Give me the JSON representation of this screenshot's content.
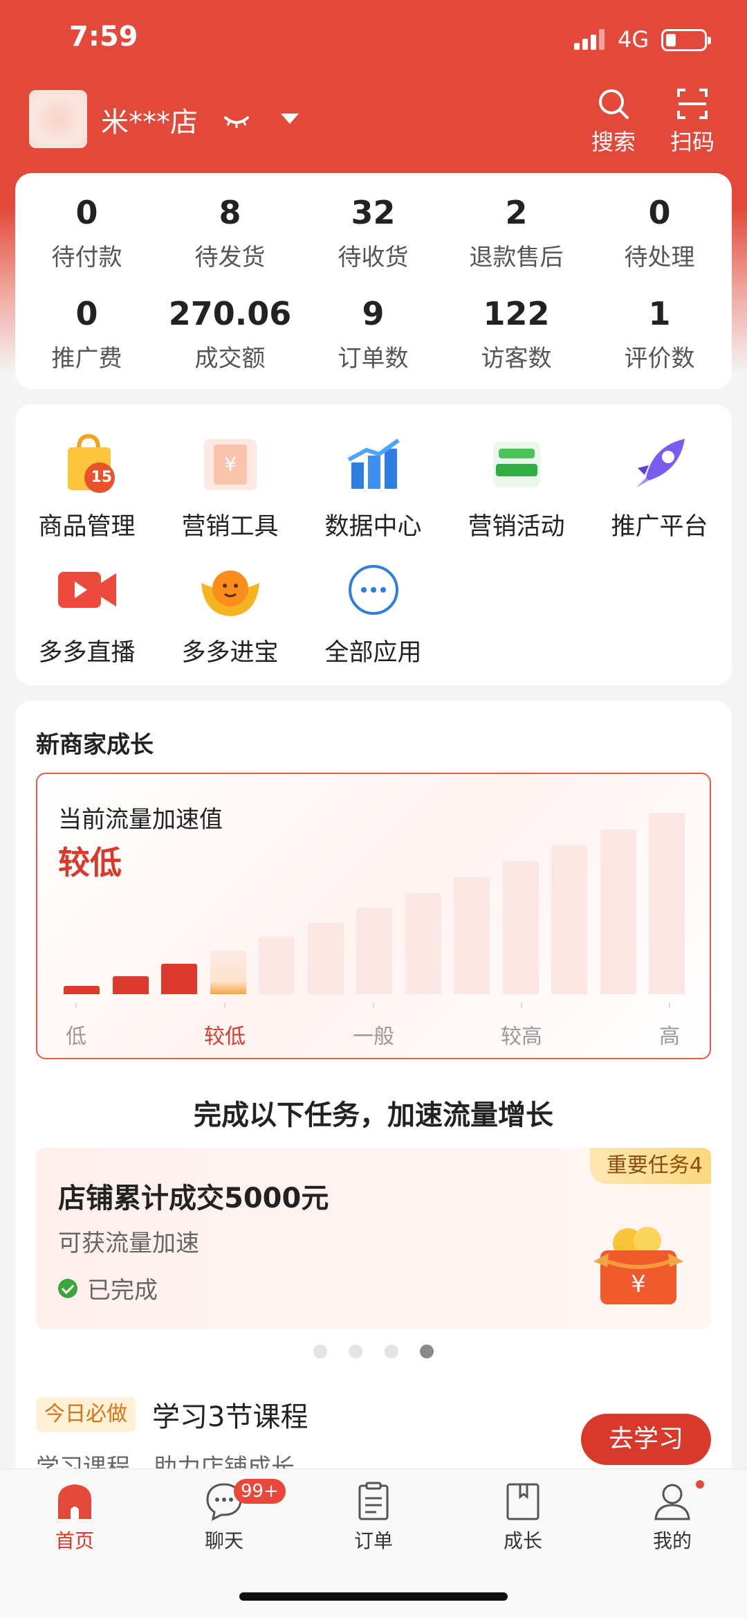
{
  "status_bar": {
    "time": "7:59",
    "network": "4G"
  },
  "header": {
    "shop_name": "米***店",
    "search_label": "搜索",
    "scan_label": "扫码"
  },
  "stats": [
    {
      "value": "0",
      "label": "待付款"
    },
    {
      "value": "8",
      "label": "待发货"
    },
    {
      "value": "32",
      "label": "待收货"
    },
    {
      "value": "2",
      "label": "退款售后"
    },
    {
      "value": "0",
      "label": "待处理"
    },
    {
      "value": "0",
      "label": "推广费"
    },
    {
      "value": "270.06",
      "label": "成交额"
    },
    {
      "value": "9",
      "label": "订单数"
    },
    {
      "value": "122",
      "label": "访客数"
    },
    {
      "value": "1",
      "label": "评价数"
    }
  ],
  "apps": [
    {
      "label": "商品管理",
      "icon": "shopping-bag-icon",
      "badge": "15"
    },
    {
      "label": "营销工具",
      "icon": "coupon-icon"
    },
    {
      "label": "数据中心",
      "icon": "bar-chart-icon"
    },
    {
      "label": "营销活动",
      "icon": "campaign-icon"
    },
    {
      "label": "推广平台",
      "icon": "rocket-icon"
    },
    {
      "label": "多多直播",
      "icon": "live-video-icon"
    },
    {
      "label": "多多进宝",
      "icon": "ingot-icon"
    },
    {
      "label": "全部应用",
      "icon": "more-icon"
    }
  ],
  "growth": {
    "title": "新商家成长",
    "flow_label": "当前流量加速值",
    "flow_value": "较低",
    "levels": [
      "低",
      "较低",
      "一般",
      "较高",
      "高"
    ],
    "active_level": 1,
    "bar_count": 13,
    "filled_bars": 3,
    "task_heading": "完成以下任务，加速流量增长",
    "task": {
      "badge": "重要任务4",
      "title": "店铺累计成交5000元",
      "subtitle": "可获流量加速",
      "status": "已完成"
    },
    "carousel_pages": 4,
    "carousel_active": 4,
    "course": {
      "tag": "今日必做",
      "title": "学习3节课程",
      "subtitle": "学习课程，助力店铺成长",
      "button": "去学习"
    }
  },
  "tabbar": [
    {
      "label": "首页",
      "icon": "home-icon",
      "active": true
    },
    {
      "label": "聊天",
      "icon": "chat-icon",
      "badge": "99+"
    },
    {
      "label": "订单",
      "icon": "order-icon"
    },
    {
      "label": "成长",
      "icon": "book-icon"
    },
    {
      "label": "我的",
      "icon": "profile-icon",
      "dot": true
    }
  ],
  "colors": {
    "brand": "#e3493a",
    "accent": "#d9392b"
  }
}
